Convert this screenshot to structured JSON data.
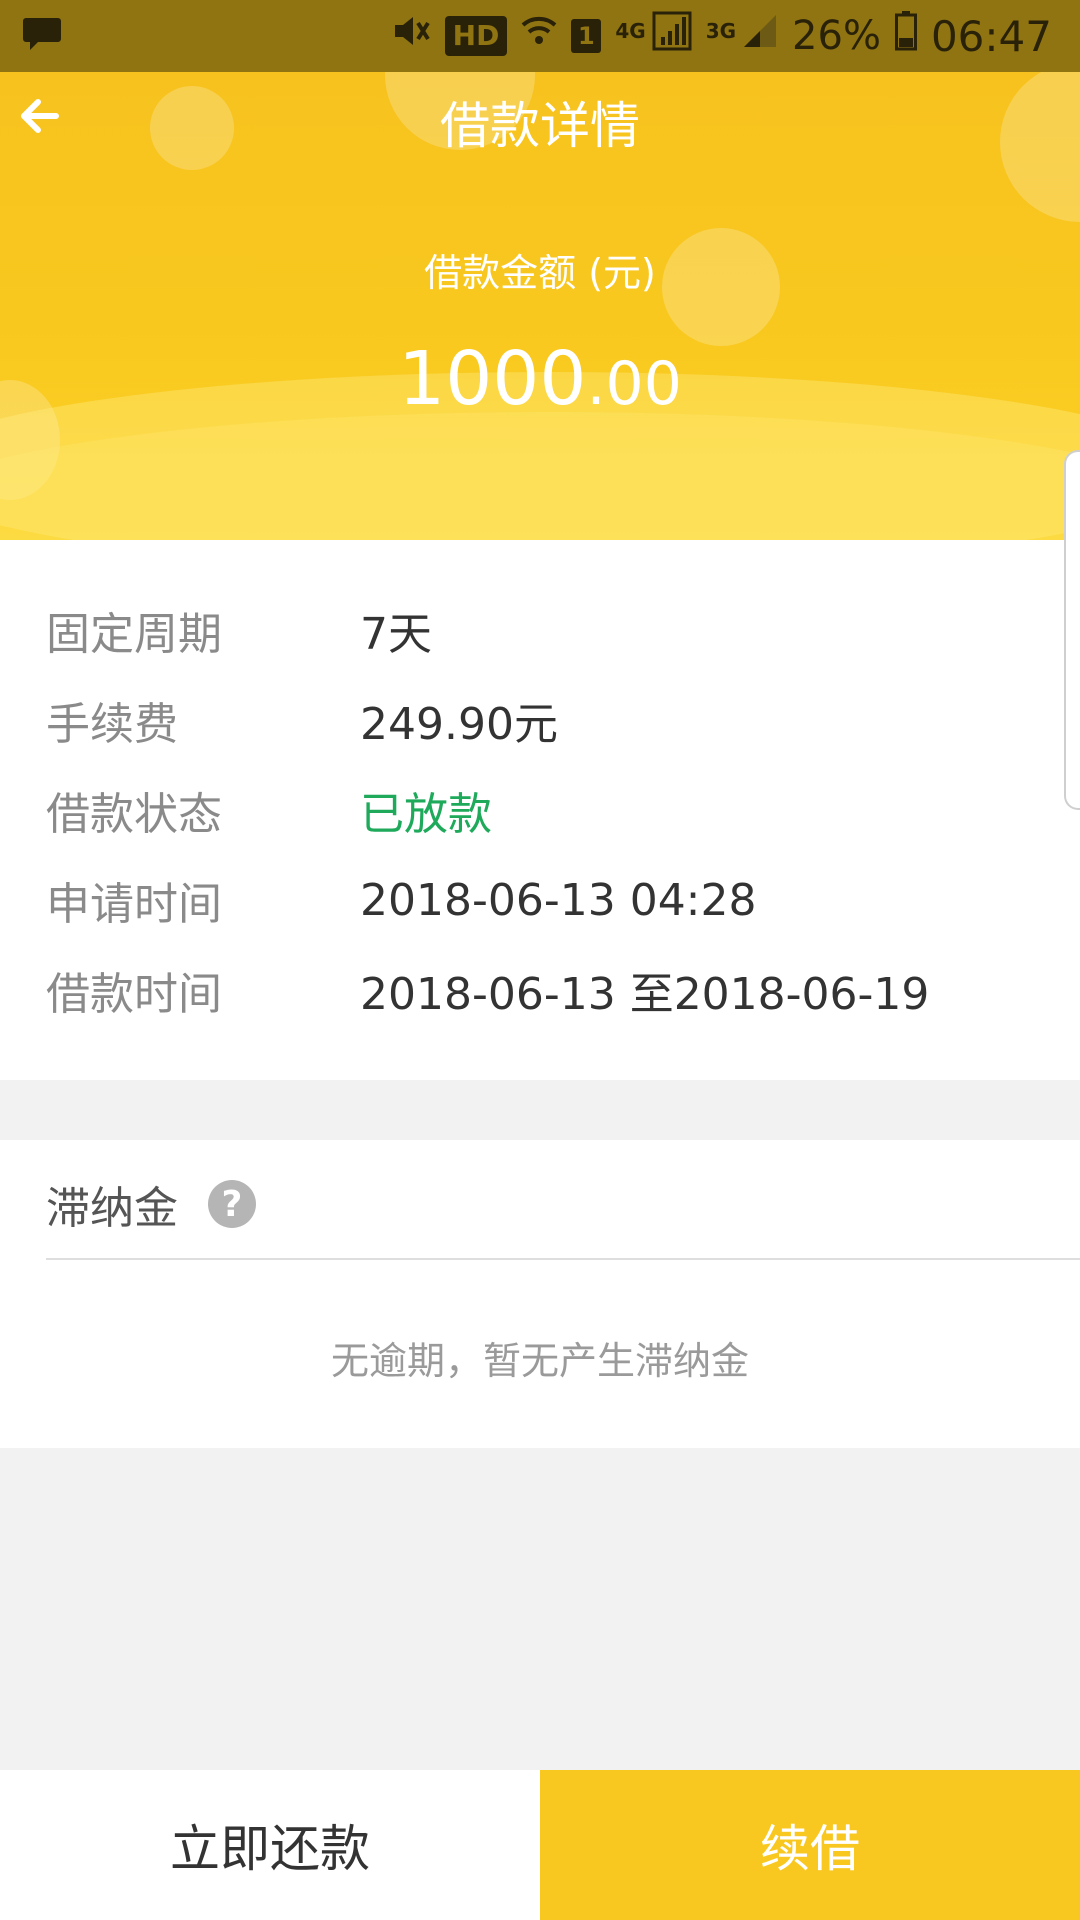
{
  "status_bar": {
    "hd": "HD",
    "sim": "1",
    "net_4g": "4G",
    "net_3g": "3G",
    "battery": "26%",
    "time": "06:47"
  },
  "header": {
    "title": "借款详情",
    "amount_label": "借款金额 (元)",
    "amount_int": "1000",
    "amount_dec": ".00"
  },
  "details": {
    "rows": [
      {
        "label": "固定周期",
        "value": "7天"
      },
      {
        "label": "手续费",
        "value": "249.90元"
      },
      {
        "label": "借款状态",
        "value": "已放款"
      },
      {
        "label": "申请时间",
        "value": "2018-06-13 04:28"
      },
      {
        "label": "借款时间",
        "value": "2018-06-13 至2018-06-19"
      }
    ]
  },
  "late_fee": {
    "title": "滞纳金",
    "help": "?",
    "message": "无逾期，暂无产生滞纳金"
  },
  "actions": {
    "repay": "立即还款",
    "renew": "续借"
  },
  "colors": {
    "brand_yellow": "#f9c820",
    "status_green": "#1faa5b"
  }
}
